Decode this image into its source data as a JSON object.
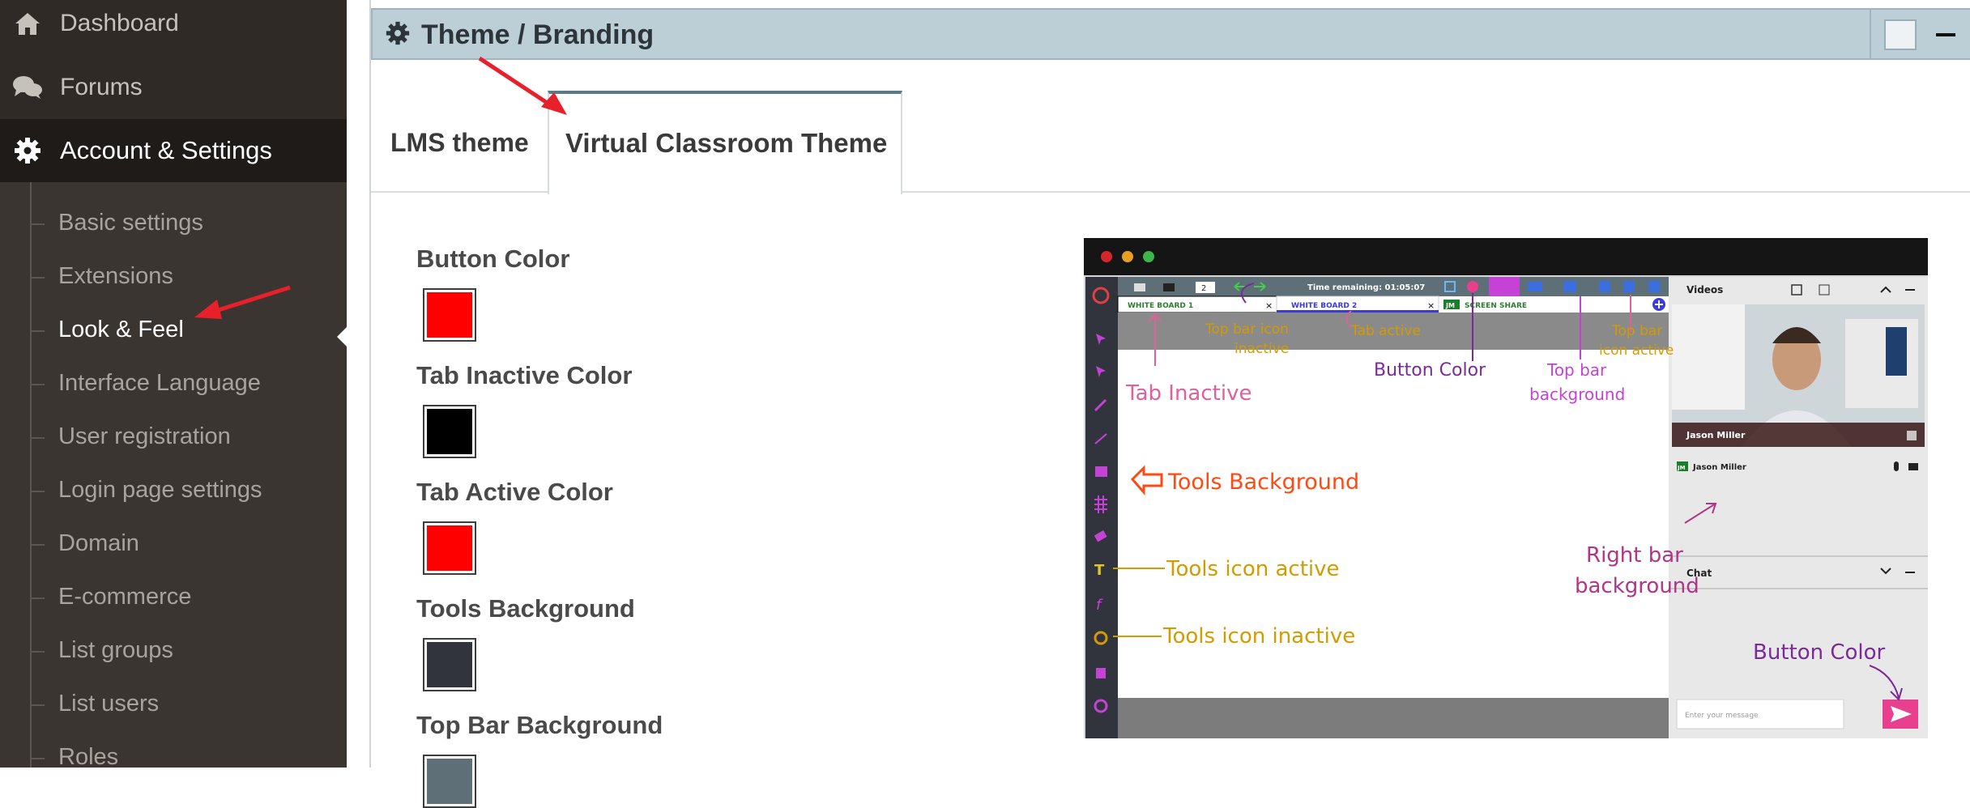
{
  "sidebar": {
    "top_items": [
      {
        "label": "Dashboard",
        "icon": "home-icon"
      },
      {
        "label": "Forums",
        "icon": "chat-bubbles-icon"
      },
      {
        "label": "Account & Settings",
        "icon": "gear-icon"
      }
    ],
    "sub_items": [
      {
        "label": "Basic settings"
      },
      {
        "label": "Extensions"
      },
      {
        "label": "Look & Feel",
        "active": true
      },
      {
        "label": "Interface Language"
      },
      {
        "label": "User registration"
      },
      {
        "label": "Login page settings"
      },
      {
        "label": "Domain"
      },
      {
        "label": "E-commerce"
      },
      {
        "label": "List groups"
      },
      {
        "label": "List users"
      },
      {
        "label": "Roles"
      }
    ]
  },
  "panel": {
    "title": "Theme / Branding",
    "tabs": [
      {
        "label": "LMS theme",
        "active": false
      },
      {
        "label": "Virtual Classroom Theme",
        "active": true
      }
    ]
  },
  "color_settings": [
    {
      "label": "Button Color",
      "color": "#ff0000"
    },
    {
      "label": "Tab Inactive Color",
      "color": "#000000"
    },
    {
      "label": "Tab Active Color",
      "color": "#ff0000"
    },
    {
      "label": "Tools Background",
      "color": "#31343d"
    },
    {
      "label": "Top Bar Background",
      "color": "#5e6f78"
    }
  ],
  "preview": {
    "timer": "Time remaining: 01:05:07",
    "page_number": "2",
    "tabs": [
      "WHITE BOARD 1",
      "WHITE BOARD 2",
      "SCREEN SHARE"
    ],
    "share_badge": "JM",
    "videos_title": "Videos",
    "participant_name": "Jason Miller",
    "participant_badge": "JM",
    "chat_title": "Chat",
    "chat_placeholder": "Enter your message",
    "annotations": {
      "tab_inactive": "Tab Inactive",
      "top_bar_icon_inactive_1": "Top bar icon",
      "top_bar_icon_inactive_2": "inactive",
      "tab_active": "Tab active",
      "button_color_top": "Button Color",
      "top_bar_bg_1": "Top bar",
      "top_bar_bg_2": "background",
      "top_bar_icon_active_1": "Top bar",
      "top_bar_icon_active_2": "icon active",
      "tools_background": "Tools Background",
      "tools_icon_active": "Tools icon active",
      "tools_icon_inactive": "Tools icon inactive",
      "right_bar_bg_1": "Right bar",
      "right_bar_bg_2": "background",
      "button_color_chat": "Button Color"
    },
    "colors": {
      "top_bar": "#5e6f78",
      "tools": "#31343d",
      "accent": "#e93f8f",
      "purple": "#c542d6",
      "blue": "#3b6fe0",
      "yellow_ann": "#d49b00",
      "pink_ann": "#e0609a",
      "orange_ann": "#ff4a12",
      "violet_ann": "#7c2a9b",
      "magenta_ann": "#b23487"
    }
  }
}
